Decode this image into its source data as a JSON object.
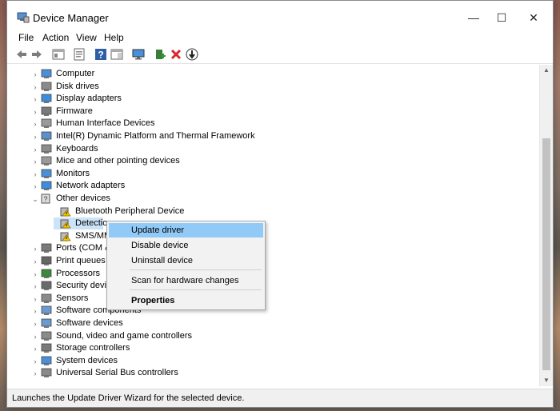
{
  "window": {
    "title": "Device Manager",
    "minimize": "—",
    "maximize": "☐",
    "close": "✕"
  },
  "menubar": {
    "items": [
      "File",
      "Action",
      "View",
      "Help"
    ]
  },
  "toolbar": {
    "buttons": [
      "back-arrow-icon",
      "forward-arrow-icon",
      "show-hide-tree-icon",
      "properties-icon",
      "help-icon",
      "action-pane-icon",
      "monitor-icon",
      "add-driver-icon",
      "remove-device-icon",
      "update-download-icon"
    ]
  },
  "tree": {
    "items": [
      {
        "label": "Computer",
        "icon": "computer-icon",
        "expanded": false
      },
      {
        "label": "Disk drives",
        "icon": "disk-icon",
        "expanded": false
      },
      {
        "label": "Display adapters",
        "icon": "display-icon",
        "expanded": false
      },
      {
        "label": "Firmware",
        "icon": "firmware-icon",
        "expanded": false
      },
      {
        "label": "Human Interface Devices",
        "icon": "hid-icon",
        "expanded": false
      },
      {
        "label": "Intel(R) Dynamic Platform and Thermal Framework",
        "icon": "intel-icon",
        "expanded": false
      },
      {
        "label": "Keyboards",
        "icon": "keyboard-icon",
        "expanded": false
      },
      {
        "label": "Mice and other pointing devices",
        "icon": "mouse-icon",
        "expanded": false
      },
      {
        "label": "Monitors",
        "icon": "monitor-icon",
        "expanded": false
      },
      {
        "label": "Network adapters",
        "icon": "network-icon",
        "expanded": false
      },
      {
        "label": "Other devices",
        "icon": "other-devices-icon",
        "expanded": true
      },
      {
        "label": "Bluetooth Peripheral Device",
        "icon": "warning-device-icon",
        "child": true
      },
      {
        "label": "Detection",
        "icon": "warning-device-icon",
        "child": true,
        "selected": true
      },
      {
        "label": "SMS/MMS",
        "icon": "warning-device-icon",
        "child": true
      },
      {
        "label": "Ports (COM &",
        "icon": "ports-icon",
        "expanded": false
      },
      {
        "label": "Print queues",
        "icon": "printer-icon",
        "expanded": false
      },
      {
        "label": "Processors",
        "icon": "processor-icon",
        "expanded": false
      },
      {
        "label": "Security device",
        "icon": "security-icon",
        "expanded": false
      },
      {
        "label": "Sensors",
        "icon": "sensor-icon",
        "expanded": false
      },
      {
        "label": "Software components",
        "icon": "software-icon",
        "expanded": false
      },
      {
        "label": "Software devices",
        "icon": "software-icon",
        "expanded": false
      },
      {
        "label": "Sound, video and game controllers",
        "icon": "sound-icon",
        "expanded": false
      },
      {
        "label": "Storage controllers",
        "icon": "storage-icon",
        "expanded": false
      },
      {
        "label": "System devices",
        "icon": "system-icon",
        "expanded": false
      },
      {
        "label": "Universal Serial Bus controllers",
        "icon": "usb-icon",
        "expanded": false
      }
    ]
  },
  "context_menu": {
    "items": [
      {
        "label": "Update driver",
        "highlighted": true,
        "bold": false
      },
      {
        "label": "Disable device",
        "highlighted": false,
        "bold": false
      },
      {
        "label": "Uninstall device",
        "highlighted": false,
        "bold": false
      },
      {
        "label": "Scan for hardware changes",
        "highlighted": false,
        "bold": false
      },
      {
        "label": "Properties",
        "highlighted": false,
        "bold": true
      }
    ]
  },
  "statusbar": {
    "text": "Launches the Update Driver Wizard for the selected device."
  },
  "colors": {
    "highlight": "#91c9f7",
    "selection": "#cce4f7",
    "remove_red": "#d9262b",
    "help_blue": "#2f5ea8"
  }
}
